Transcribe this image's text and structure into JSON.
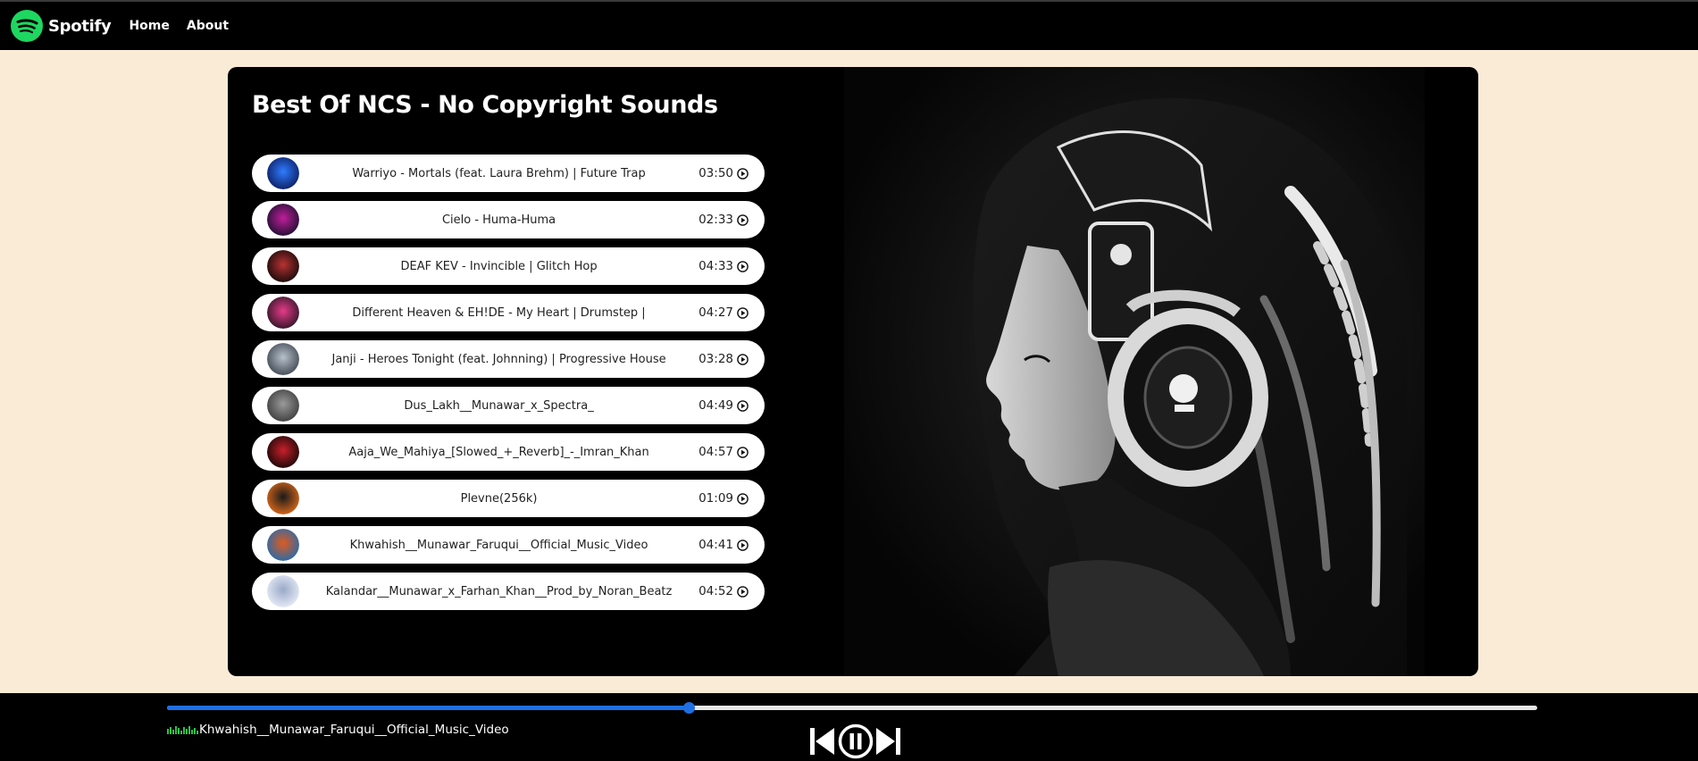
{
  "nav": {
    "brand": "Spotify",
    "links": [
      "Home",
      "About"
    ],
    "logo_color": "#1ed760"
  },
  "playlist": {
    "title": "Best Of NCS - No Copyright Sounds",
    "songs": [
      {
        "name": "Warriyo - Mortals (feat. Laura Brehm) | Future Trap",
        "duration": "03:50",
        "cover": [
          "#0b1a5e",
          "#2f7cff"
        ]
      },
      {
        "name": "Cielo - Huma-Huma",
        "duration": "02:33",
        "cover": [
          "#1a0f2e",
          "#c01e9a"
        ]
      },
      {
        "name": "DEAF KEV - Invincible | Glitch Hop",
        "duration": "04:33",
        "cover": [
          "#120808",
          "#b93232"
        ]
      },
      {
        "name": "Different Heaven & EH!DE - My Heart | Drumstep |",
        "duration": "04:27",
        "cover": [
          "#2a1424",
          "#e73b8a"
        ]
      },
      {
        "name": "Janji - Heroes Tonight (feat. Johnning) | Progressive House",
        "duration": "03:28",
        "cover": [
          "#3e4650",
          "#b8c2cc"
        ]
      },
      {
        "name": "Dus_Lakh__Munawar_x_Spectra_",
        "duration": "04:49",
        "cover": [
          "#3b3b3b",
          "#9a9a9a"
        ]
      },
      {
        "name": "Aaja_We_Mahiya_[Slowed_+_Reverb]_-_Imran_Khan",
        "duration": "04:57",
        "cover": [
          "#140606",
          "#c8202a"
        ]
      },
      {
        "name": "Plevne(256k)",
        "duration": "01:09",
        "cover": [
          "#e06a1a",
          "#1a1a1a"
        ]
      },
      {
        "name": "Khwahish__Munawar_Faruqui__Official_Music_Video",
        "duration": "04:41",
        "cover": [
          "#1f6cb0",
          "#e05a1e"
        ]
      },
      {
        "name": "Kalandar__Munawar_x_Farhan_Khan__Prod_by_Noran_Beatz",
        "duration": "04:52",
        "cover": [
          "#e9eef8",
          "#9aa9c8"
        ]
      }
    ]
  },
  "player": {
    "now_playing": "Khwahish__Munawar_Faruqui__Official_Music_Video",
    "progress": 0.381,
    "accent": "#1f6fe3",
    "eq_color": "#2ec24a",
    "state": "playing"
  },
  "icons": {
    "logo": "spotify-logo",
    "song_play": "play-circle-icon",
    "previous": "skip-previous-icon",
    "pause": "pause-circle-icon",
    "next": "skip-next-icon"
  }
}
